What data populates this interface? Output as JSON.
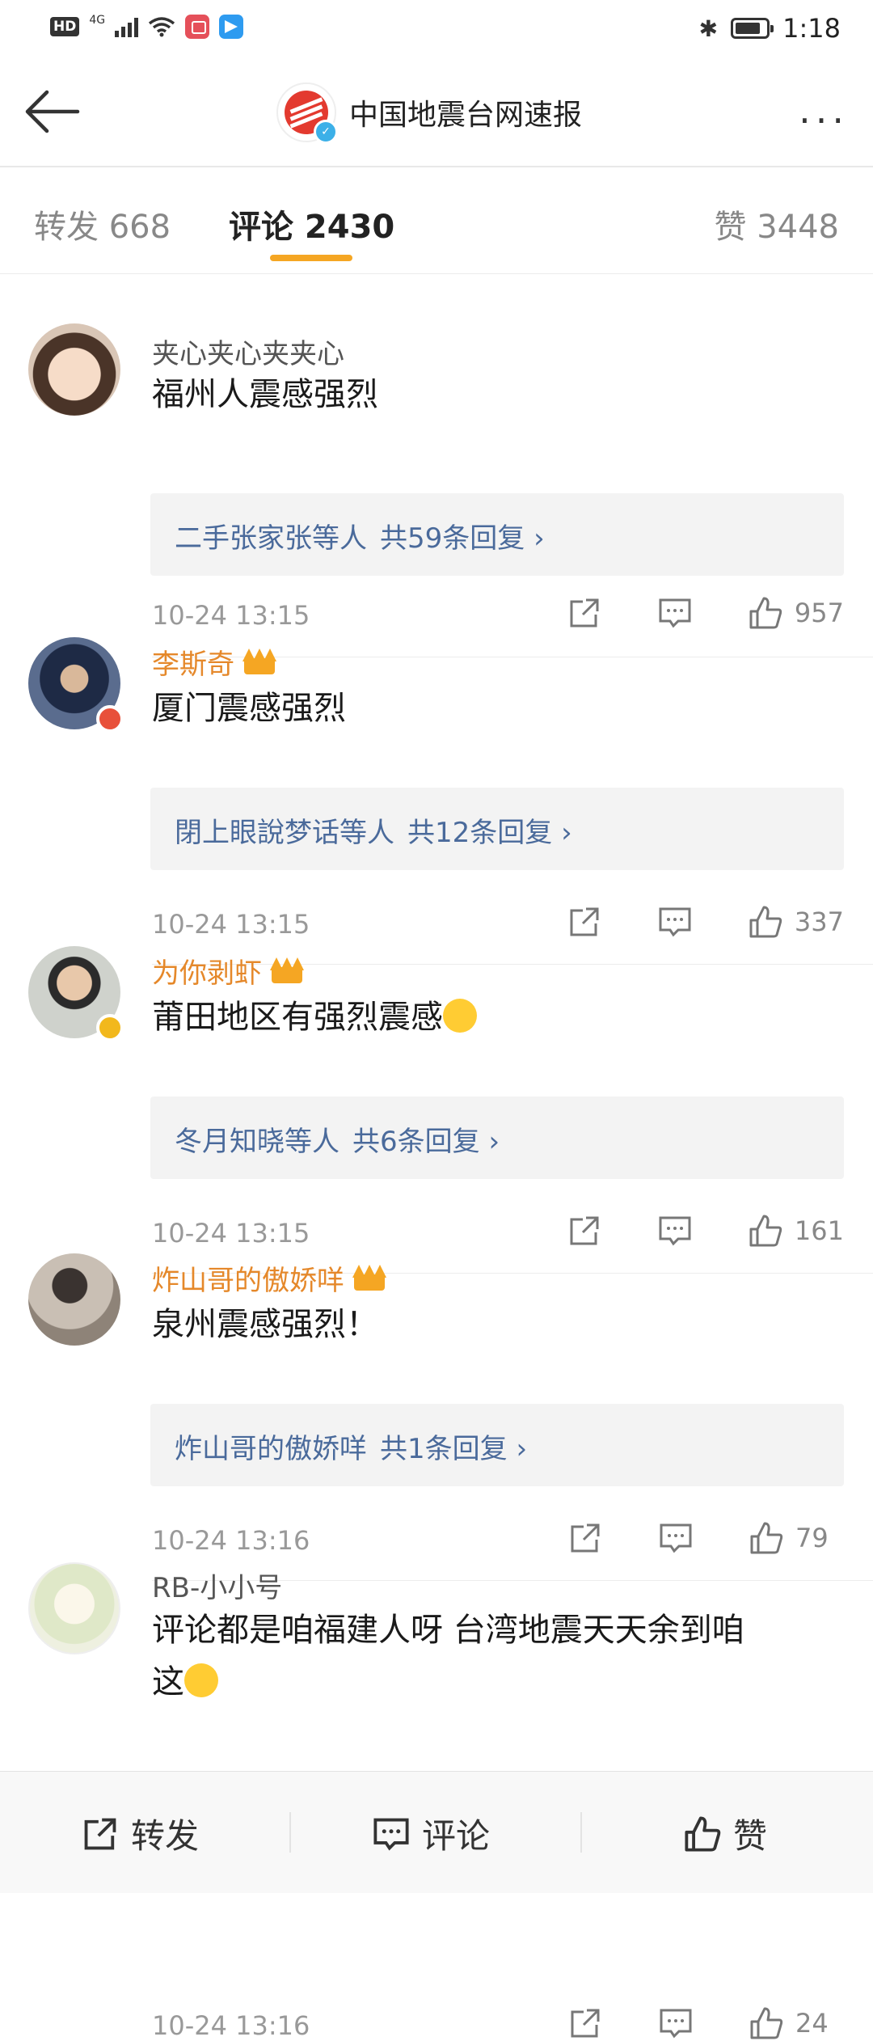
{
  "status_bar": {
    "time": "1:18",
    "hd": "HD",
    "network": "4G"
  },
  "header": {
    "title": "中国地震台网速报",
    "more_label": "···"
  },
  "tabs": {
    "repost": "转发 668",
    "comment": "评论 2430",
    "like": "赞 3448"
  },
  "comments": [
    {
      "name": "夹心夹心夹夹心",
      "name_color": "#555555",
      "crown": false,
      "text": "福州人震感强烈",
      "reply_users": "二手张家张等人",
      "reply_count": "共59条回复 ›",
      "time": "10-24 13:15",
      "likes": "957"
    },
    {
      "name": "李斯奇",
      "name_color": "#e5882a",
      "crown": true,
      "text": "厦门震感强烈",
      "reply_users": "閉上眼說梦话等人",
      "reply_count": "共12条回复 ›",
      "time": "10-24 13:15",
      "likes": "337"
    },
    {
      "name": "为你剥虾",
      "name_color": "#e5882a",
      "crown": true,
      "text": "莆田地区有强烈震感",
      "reply_users": "冬月知晓等人",
      "reply_count": "共6条回复 ›",
      "time": "10-24 13:15",
      "likes": "161"
    },
    {
      "name": "炸山哥的傲娇咩",
      "name_color": "#e5882a",
      "crown": true,
      "text": "泉州震感强烈！",
      "reply_users": "炸山哥的傲娇咩",
      "reply_count": "共1条回复 ›",
      "time": "10-24 13:16",
      "likes": "79"
    },
    {
      "name": "RB-小小号",
      "name_color": "#555555",
      "crown": false,
      "text_line1": "评论都是咱福建人呀 台湾地震天天余到咱",
      "text_line2": "这",
      "time": "10-24 13:16",
      "likes": "24"
    }
  ],
  "bottom_bar": {
    "repost": "转发",
    "comment": "评论",
    "like": "赞"
  },
  "colors": {
    "accent": "#f5a623",
    "vip_name": "#e5882a",
    "link": "#4a6a9b"
  }
}
